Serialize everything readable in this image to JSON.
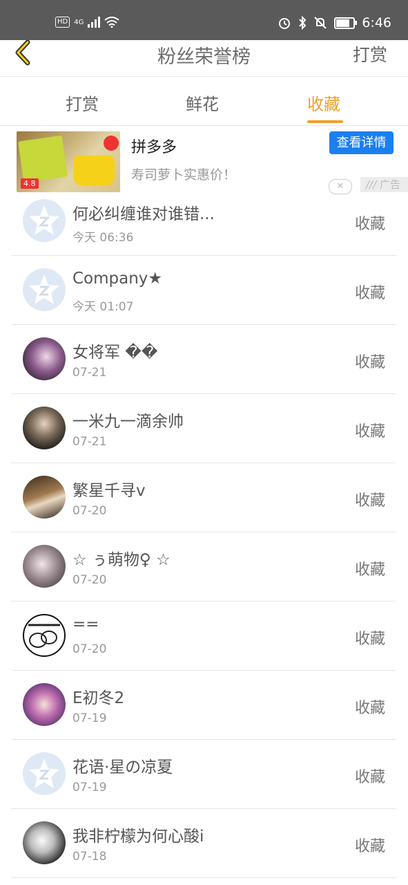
{
  "status_bar": {
    "network_badge": "HD",
    "signal_label": "4G",
    "time": "6:46"
  },
  "nav": {
    "title": "粉丝荣誉榜",
    "action": "打赏"
  },
  "tabs": [
    {
      "label": "打赏",
      "active": false
    },
    {
      "label": "鲜花",
      "active": false
    },
    {
      "label": "收藏",
      "active": true
    }
  ],
  "ad": {
    "title": "拼多多",
    "subtitle": "寿司萝卜实惠价！",
    "cta": "查看详情",
    "label": "广告",
    "image_rating": "4.8"
  },
  "colors": {
    "accent": "#f0a02a",
    "cta_blue": "#1b7ff0",
    "status_bar": "#5a5a5a"
  },
  "fans": [
    {
      "name": "何必纠缠谁对谁错...",
      "time": "今天 06:36",
      "action": "收藏",
      "avatar": "default"
    },
    {
      "name": "Company★",
      "time": "今天 01:07",
      "action": "收藏",
      "avatar": "default"
    },
    {
      "name": "女将军 ��",
      "time": "07-21",
      "action": "收藏",
      "avatar": "photo-purple"
    },
    {
      "name": "一米九一滴余帅",
      "time": "07-21",
      "action": "收藏",
      "avatar": "photo-dark"
    },
    {
      "name": "繁星千寻v",
      "time": "07-20",
      "action": "收藏",
      "avatar": "photo-brown"
    },
    {
      "name": "☆ ぅ萌物♀ ☆",
      "time": "07-20",
      "action": "收藏",
      "avatar": "photo-gray"
    },
    {
      "name": "==",
      "time": "07-20",
      "action": "收藏",
      "avatar": "photo-sketch"
    },
    {
      "name": "E初冬2",
      "time": "07-19",
      "action": "收藏",
      "avatar": "photo-anime"
    },
    {
      "name": "花语·星の凉夏",
      "time": "07-19",
      "action": "收藏",
      "avatar": "default"
    },
    {
      "name": "我非柠檬为何心酸i",
      "time": "07-18",
      "action": "收藏",
      "avatar": "photo-bw"
    }
  ]
}
